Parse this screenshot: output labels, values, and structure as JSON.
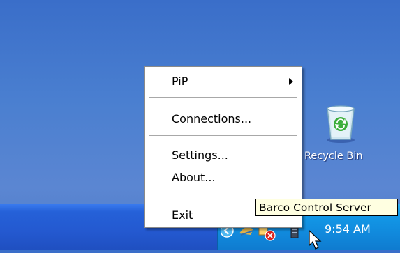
{
  "menu": {
    "items": [
      {
        "label": "PiP",
        "has_submenu": true
      },
      {
        "label": "Connections..."
      },
      {
        "label": "Settings..."
      },
      {
        "label": "About..."
      },
      {
        "label": "Exit"
      }
    ]
  },
  "desktop": {
    "recycle_bin_label": "Recycle Bin"
  },
  "tooltip": {
    "text": "Barco Control Server"
  },
  "taskbar": {
    "clock": "9:54 AM"
  },
  "icons": {
    "recycle_bin": "recycle-bin-icon",
    "show_hidden": "chevron-left-icon",
    "tray": [
      "network-icon",
      "security-alert-icon",
      "barco-control-server-icon"
    ],
    "cursor": "mouse-pointer-icon"
  },
  "colors": {
    "desktop_blue": "#4a7fd0",
    "tray_blue": "#129ae8",
    "tooltip_bg": "#ffffe1"
  }
}
